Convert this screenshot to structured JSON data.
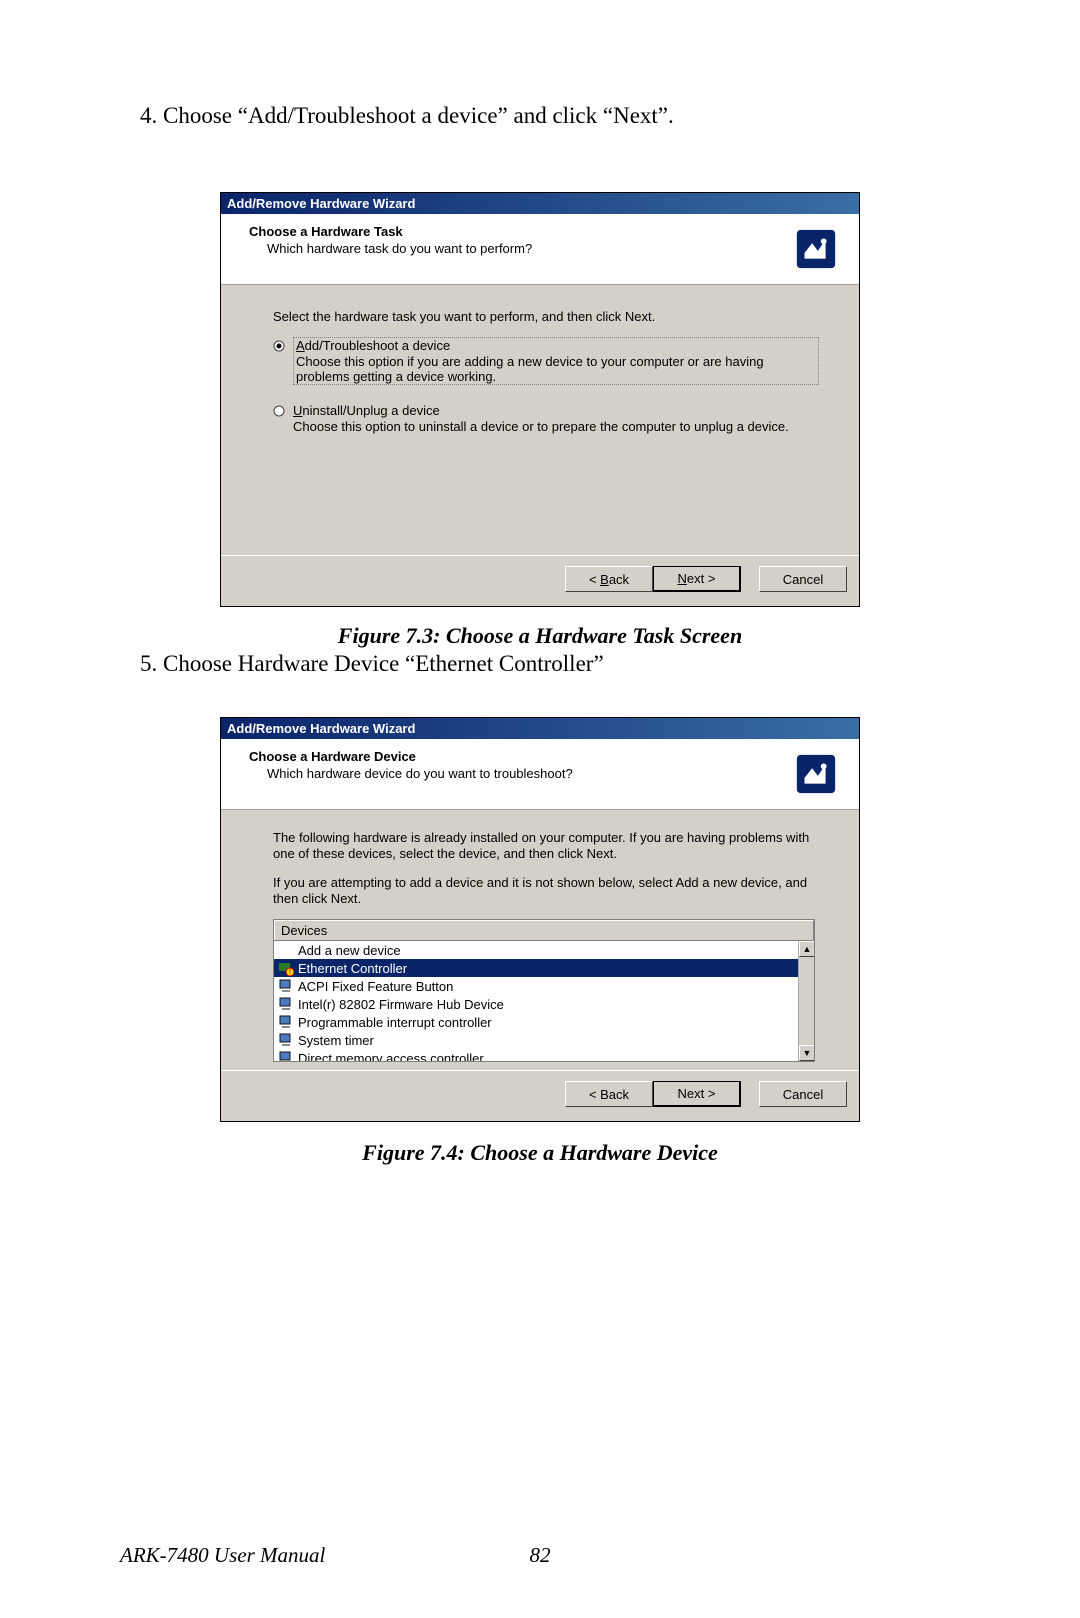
{
  "step4": "4. Choose “Add/Troubleshoot a device” and click “Next”.",
  "wizard1": {
    "title": "Add/Remove Hardware Wizard",
    "header_title": "Choose a Hardware Task",
    "header_sub": "Which hardware task do you want to perform?",
    "instruction": "Select the hardware task you want to perform, and then click Next.",
    "opt1_label": "Add/Troubleshoot a device",
    "opt1_desc": "Choose this option if you are adding a new device to your computer or are having problems getting a device working.",
    "opt2_label": "Uninstall/Unplug a device",
    "opt2_desc": "Choose this option to uninstall a device or to prepare the computer to unplug a device.",
    "back": "< Back",
    "next": "Next >",
    "cancel": "Cancel"
  },
  "caption1": "Figure 7.3: Choose a Hardware Task Screen",
  "step5": "5. Choose Hardware Device “Ethernet Controller”",
  "wizard2": {
    "title": "Add/Remove Hardware Wizard",
    "header_title": "Choose a Hardware Device",
    "header_sub": "Which hardware device do you want to troubleshoot?",
    "para1": "The following hardware is already installed on your computer. If you are having problems with one of these devices, select the device, and then click Next.",
    "para2": "If you are attempting to add a device and it is not shown below, select Add a new device, and then click Next.",
    "col_header": "Devices",
    "items": [
      "Add a new device",
      "Ethernet Controller",
      "ACPI Fixed Feature Button",
      "Intel(r) 82802 Firmware Hub Device",
      "Programmable interrupt controller",
      "System timer",
      "Direct memory access controller"
    ],
    "back": "< Back",
    "next": "Next >",
    "cancel": "Cancel"
  },
  "caption2": "Figure 7.4: Choose a Hardware Device",
  "footer_manual": "ARK-7480 User Manual",
  "footer_page": "82"
}
